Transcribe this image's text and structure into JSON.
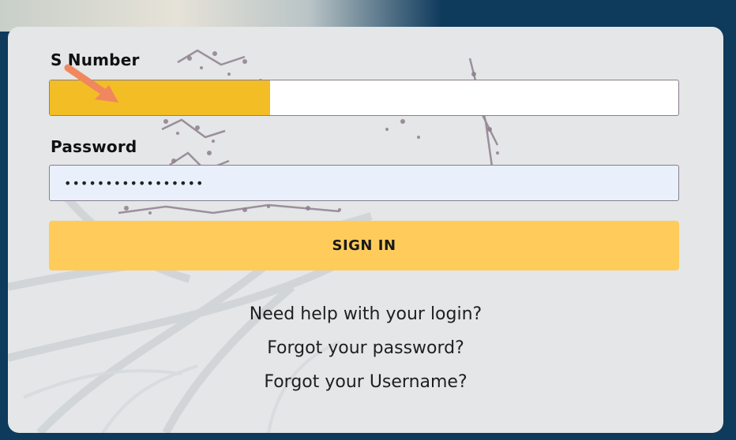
{
  "form": {
    "snumber_label": "S Number",
    "snumber_value": "",
    "password_label": "Password",
    "password_value": "•••••••••••••••••",
    "signin_label": "SIGN IN"
  },
  "links": {
    "help": "Need help with your login?",
    "forgot_password": "Forgot your password?",
    "forgot_username": "Forgot your Username?"
  },
  "annotation": {
    "arrow_icon": "arrow-pointer-icon",
    "arrow_color": "#f0875e",
    "redaction_color": "#f2bd25"
  },
  "colors": {
    "page_background": "#0e3a5c",
    "card_background": "#e4e6e7",
    "button_background": "#ffcc5c",
    "password_field_background": "#e9f0fc"
  }
}
